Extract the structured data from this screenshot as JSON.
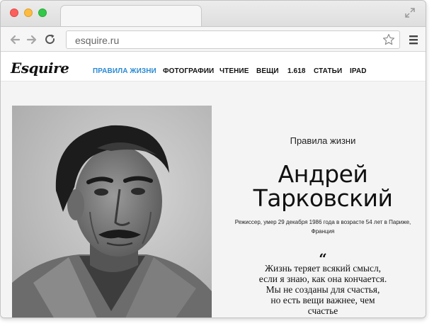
{
  "browser": {
    "url": "esquire.ru",
    "icons": {
      "back": "arrow-left-icon",
      "forward": "arrow-right-icon",
      "reload": "reload-icon",
      "bookmark": "star-icon",
      "menu": "hamburger-menu-icon",
      "fullscreen": "expand-icon"
    }
  },
  "site": {
    "logo": "Esquire",
    "nav": [
      {
        "label": "ПРАВИЛА ЖИЗНИ",
        "active": true
      },
      {
        "label": "ФОТОГРАФИИ",
        "active": false
      },
      {
        "label": "ЧТЕНИЕ",
        "active": false
      },
      {
        "label": "ВЕЩИ",
        "active": false
      },
      {
        "label": "1.618",
        "active": false
      },
      {
        "label": "СТАТЬИ",
        "active": false
      },
      {
        "label": "IPAD",
        "active": false
      }
    ],
    "accent_color": "#2a8ad4"
  },
  "article": {
    "rubric": "Правила жизни",
    "name_line1": "Андрей",
    "name_line2": "Тарковский",
    "bio": "Режиссер, умер 29 декабря 1986 года в возрасте 54 лет в Париже, Франция",
    "quote_mark": "“",
    "quote_lines": [
      "Жизнь теряет всякий смысл,",
      "если я знаю, как она кончается.",
      "Мы не созданы для счастья,",
      "но есть вещи важнее, чем",
      "счастье"
    ]
  }
}
